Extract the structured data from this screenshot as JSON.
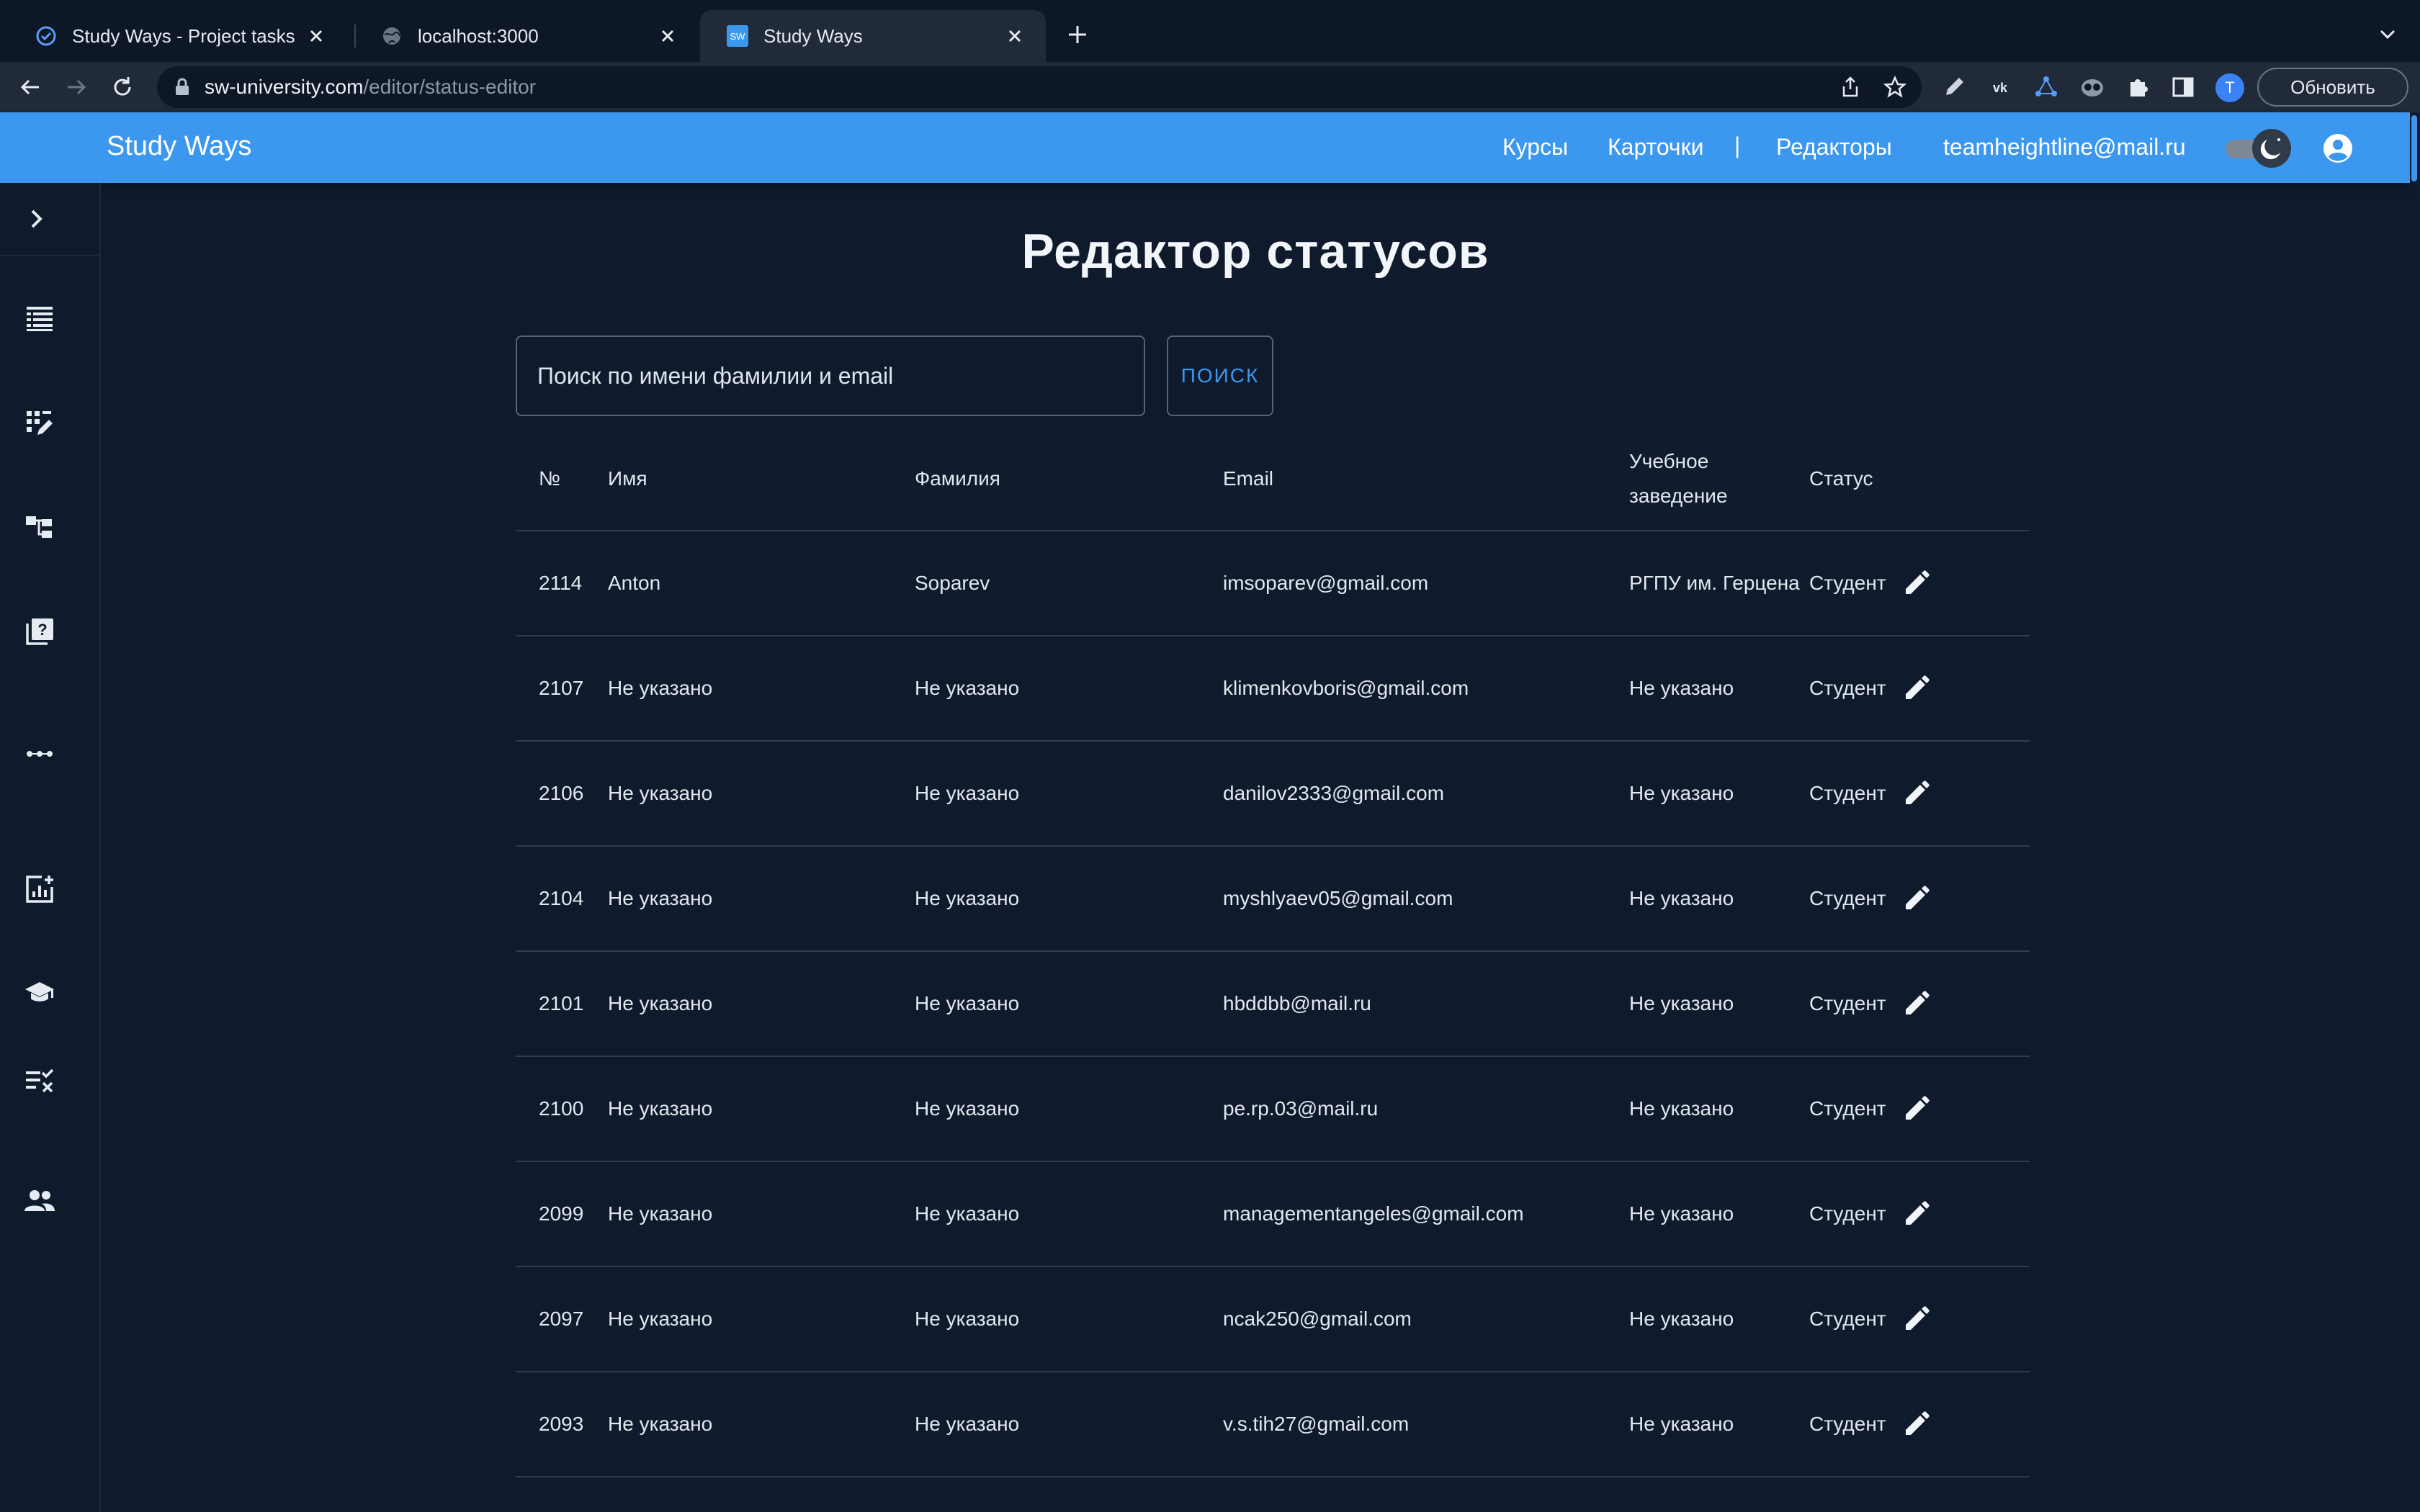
{
  "browser": {
    "tabs": [
      {
        "label": "Study Ways - Project tasks - W",
        "favicon": "task-check-icon",
        "active": false
      },
      {
        "label": "localhost:3000",
        "favicon": "globe-icon",
        "active": false
      },
      {
        "label": "Study Ways",
        "favicon": "sw-logo-icon",
        "favicon_text": "SW",
        "active": true
      }
    ],
    "url_host": "sw-university.com",
    "url_path": "/editor/status-editor",
    "profile_initial": "T",
    "update_label": "Обновить"
  },
  "header": {
    "brand": "Study Ways",
    "nav": [
      "Курсы",
      "Карточки",
      "Редакторы"
    ],
    "separator": "|",
    "user_email": "teamheightline@mail.ru"
  },
  "sidebar": {
    "icons": [
      "chevron-right-icon",
      "table-list-icon",
      "edit-grid-icon",
      "hierarchy-icon",
      "quiz-icon",
      "more-dots-icon",
      "add-chart-icon",
      "school-icon",
      "checklist-icon",
      "people-icon"
    ]
  },
  "main": {
    "title": "Редактор статусов",
    "search_placeholder": "Поиск по имени фамилии и email",
    "search_button": "ПОИСК"
  },
  "table": {
    "columns": [
      "№",
      "Имя",
      "Фамилия",
      "Email",
      "Учебное заведение",
      "Статус"
    ],
    "rows": [
      {
        "id": "2114",
        "name": "Anton",
        "surname": "Soparev",
        "email": "imsoparev@gmail.com",
        "institution": "РГПУ им. Герцена",
        "status": "Студент"
      },
      {
        "id": "2107",
        "name": "Не указано",
        "surname": "Не указано",
        "email": "klimenkovboris@gmail.com",
        "institution": "Не указано",
        "status": "Студент"
      },
      {
        "id": "2106",
        "name": "Не указано",
        "surname": "Не указано",
        "email": "danilov2333@gmail.com",
        "institution": "Не указано",
        "status": "Студент"
      },
      {
        "id": "2104",
        "name": "Не указано",
        "surname": "Не указано",
        "email": "myshlyaev05@gmail.com",
        "institution": "Не указано",
        "status": "Студент"
      },
      {
        "id": "2101",
        "name": "Не указано",
        "surname": "Не указано",
        "email": "hbddbb@mail.ru",
        "institution": "Не указано",
        "status": "Студент"
      },
      {
        "id": "2100",
        "name": "Не указано",
        "surname": "Не указано",
        "email": "pe.rp.03@mail.ru",
        "institution": "Не указано",
        "status": "Студент"
      },
      {
        "id": "2099",
        "name": "Не указано",
        "surname": "Не указано",
        "email": "managementangeles@gmail.com",
        "institution": "Не указано",
        "status": "Студент"
      },
      {
        "id": "2097",
        "name": "Не указано",
        "surname": "Не указано",
        "email": "ncak250@gmail.com",
        "institution": "Не указано",
        "status": "Студент"
      },
      {
        "id": "2093",
        "name": "Не указано",
        "surname": "Не указано",
        "email": "v.s.tih27@gmail.com",
        "institution": "Не указано",
        "status": "Студент"
      }
    ]
  },
  "colors": {
    "appbar": "#3c98ee",
    "background": "#0f1a2c",
    "accent": "#3c98ee",
    "row_divider": "#2f3b4e"
  }
}
